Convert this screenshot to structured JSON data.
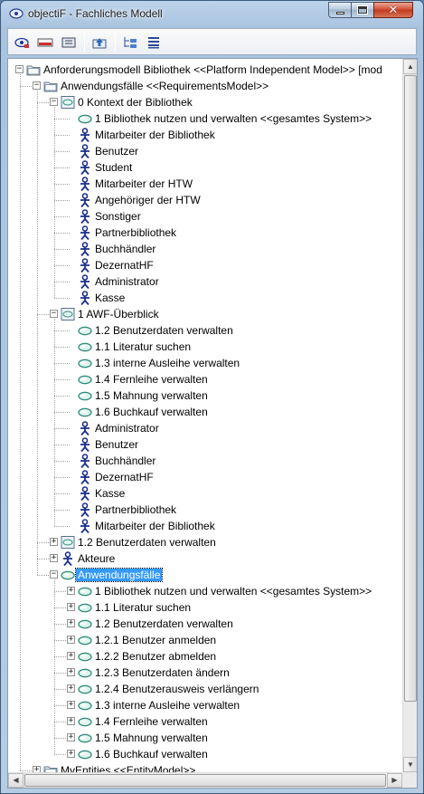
{
  "window": {
    "title": "objectiF - Fachliches Modell",
    "min_label": "",
    "close_glyph": "✕"
  },
  "toolbar": {
    "buttons": [
      {
        "name": "model-view-icon"
      },
      {
        "name": "diagram-icon"
      },
      {
        "name": "package-icon"
      },
      {
        "name": "navigate-up-icon"
      },
      {
        "name": "tree-expand-icon"
      },
      {
        "name": "list-view-icon"
      }
    ]
  },
  "tree": {
    "rows": [
      {
        "label": "Anforderungsmodell Bibliothek <<Platform Independent Model>> [mod",
        "icon": "folder-icon",
        "level": 0,
        "expander": "−",
        "selected": false
      },
      {
        "label": "Anwendungsfälle <<RequirementsModel>>",
        "icon": "folder-icon",
        "level": 1,
        "expander": "−",
        "selected": false
      },
      {
        "label": "0 Kontext der Bibliothek",
        "icon": "usecase-diagram-icon",
        "level": 2,
        "expander": "−",
        "selected": false
      },
      {
        "label": "1 Bibliothek nutzen und verwalten <<gesamtes System>>",
        "icon": "usecase-icon",
        "level": 3,
        "expander": "",
        "selected": false
      },
      {
        "label": "Mitarbeiter der Bibliothek",
        "icon": "actor-icon",
        "level": 3,
        "expander": "",
        "selected": false
      },
      {
        "label": "Benutzer",
        "icon": "actor-icon",
        "level": 3,
        "expander": "",
        "selected": false
      },
      {
        "label": "Student",
        "icon": "actor-icon",
        "level": 3,
        "expander": "",
        "selected": false
      },
      {
        "label": "Mitarbeiter der HTW",
        "icon": "actor-icon",
        "level": 3,
        "expander": "",
        "selected": false
      },
      {
        "label": "Angehöriger der HTW",
        "icon": "actor-icon",
        "level": 3,
        "expander": "",
        "selected": false
      },
      {
        "label": "Sonstiger",
        "icon": "actor-icon",
        "level": 3,
        "expander": "",
        "selected": false
      },
      {
        "label": "Partnerbibliothek",
        "icon": "actor-icon",
        "level": 3,
        "expander": "",
        "selected": false
      },
      {
        "label": "Buchhändler",
        "icon": "actor-icon",
        "level": 3,
        "expander": "",
        "selected": false
      },
      {
        "label": "DezernatHF",
        "icon": "actor-icon",
        "level": 3,
        "expander": "",
        "selected": false
      },
      {
        "label": "Administrator",
        "icon": "actor-icon",
        "level": 3,
        "expander": "",
        "selected": false
      },
      {
        "label": "Kasse",
        "icon": "actor-icon",
        "level": 3,
        "expander": "",
        "selected": false
      },
      {
        "label": "1 AWF-Überblick",
        "icon": "usecase-diagram-icon",
        "level": 2,
        "expander": "−",
        "selected": false
      },
      {
        "label": "1.2 Benutzerdaten verwalten",
        "icon": "usecase-icon",
        "level": 3,
        "expander": "",
        "selected": false
      },
      {
        "label": "1.1 Literatur suchen",
        "icon": "usecase-icon",
        "level": 3,
        "expander": "",
        "selected": false
      },
      {
        "label": "1.3 interne Ausleihe verwalten",
        "icon": "usecase-icon",
        "level": 3,
        "expander": "",
        "selected": false
      },
      {
        "label": "1.4 Fernleihe verwalten",
        "icon": "usecase-icon",
        "level": 3,
        "expander": "",
        "selected": false
      },
      {
        "label": "1.5 Mahnung verwalten",
        "icon": "usecase-icon",
        "level": 3,
        "expander": "",
        "selected": false
      },
      {
        "label": "1.6 Buchkauf verwalten",
        "icon": "usecase-icon",
        "level": 3,
        "expander": "",
        "selected": false
      },
      {
        "label": "Administrator",
        "icon": "actor-icon",
        "level": 3,
        "expander": "",
        "selected": false
      },
      {
        "label": "Benutzer",
        "icon": "actor-icon",
        "level": 3,
        "expander": "",
        "selected": false
      },
      {
        "label": "Buchhändler",
        "icon": "actor-icon",
        "level": 3,
        "expander": "",
        "selected": false
      },
      {
        "label": "DezernatHF",
        "icon": "actor-icon",
        "level": 3,
        "expander": "",
        "selected": false
      },
      {
        "label": "Kasse",
        "icon": "actor-icon",
        "level": 3,
        "expander": "",
        "selected": false
      },
      {
        "label": "Partnerbibliothek",
        "icon": "actor-icon",
        "level": 3,
        "expander": "",
        "selected": false
      },
      {
        "label": "Mitarbeiter der Bibliothek",
        "icon": "actor-icon",
        "level": 3,
        "expander": "",
        "selected": false
      },
      {
        "label": "1.2 Benutzerdaten verwalten",
        "icon": "usecase-diagram-icon",
        "level": 2,
        "expander": "+",
        "selected": false
      },
      {
        "label": "Akteure",
        "icon": "actor-icon",
        "level": 2,
        "expander": "+",
        "selected": false
      },
      {
        "label": "Anwendungsfälle",
        "icon": "usecase-icon",
        "level": 2,
        "expander": "−",
        "selected": true
      },
      {
        "label": "1 Bibliothek nutzen und verwalten <<gesamtes System>>",
        "icon": "usecase-icon",
        "level": 3,
        "expander": "+",
        "selected": false
      },
      {
        "label": "1.1 Literatur suchen",
        "icon": "usecase-icon",
        "level": 3,
        "expander": "+",
        "selected": false
      },
      {
        "label": "1.2 Benutzerdaten verwalten",
        "icon": "usecase-icon",
        "level": 3,
        "expander": "+",
        "selected": false
      },
      {
        "label": "1.2.1 Benutzer anmelden",
        "icon": "usecase-icon",
        "level": 3,
        "expander": "+",
        "selected": false
      },
      {
        "label": "1.2.2 Benutzer abmelden",
        "icon": "usecase-icon",
        "level": 3,
        "expander": "+",
        "selected": false
      },
      {
        "label": "1.2.3 Benutzerdaten ändern",
        "icon": "usecase-icon",
        "level": 3,
        "expander": "+",
        "selected": false
      },
      {
        "label": "1.2.4 Benutzerausweis verlängern",
        "icon": "usecase-icon",
        "level": 3,
        "expander": "+",
        "selected": false
      },
      {
        "label": "1.3 interne Ausleihe verwalten",
        "icon": "usecase-icon",
        "level": 3,
        "expander": "+",
        "selected": false
      },
      {
        "label": "1.4 Fernleihe verwalten",
        "icon": "usecase-icon",
        "level": 3,
        "expander": "+",
        "selected": false
      },
      {
        "label": "1.5 Mahnung verwalten",
        "icon": "usecase-icon",
        "level": 3,
        "expander": "+",
        "selected": false
      },
      {
        "label": "1.6 Buchkauf verwalten",
        "icon": "usecase-icon",
        "level": 3,
        "expander": "+",
        "selected": false
      },
      {
        "label": "MyEntities <<EntityModel>>",
        "icon": "folder-icon",
        "level": 1,
        "expander": "+",
        "selected": false
      }
    ]
  },
  "colors": {
    "selection": "#3399ff",
    "actor": "#1a2e8c",
    "usecase": "#2f8a7a"
  }
}
